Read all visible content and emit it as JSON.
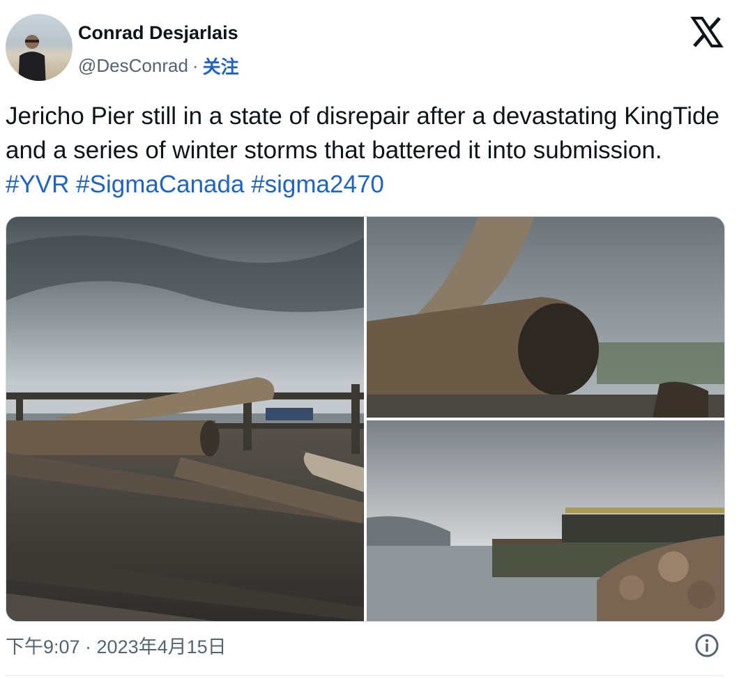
{
  "author": {
    "name": "Conrad Desjarlais",
    "handle": "@DesConrad",
    "separator": "·",
    "follow_label": "关注"
  },
  "tweet": {
    "text": "Jericho Pier still in a state of disrepair after a devastating KingTide and a series of winter storms that battered it into submission.",
    "hashtags": [
      "#YVR",
      "#SigmaCanada",
      "#sigma2470"
    ]
  },
  "timestamp": "下午9:07 · 2023年4月15日",
  "icons": {
    "platform_logo": "x-logo-icon",
    "info": "info-icon"
  },
  "colors": {
    "link": "#1d64c8",
    "secondary_text": "#536471",
    "primary_text": "#0f1419"
  }
}
